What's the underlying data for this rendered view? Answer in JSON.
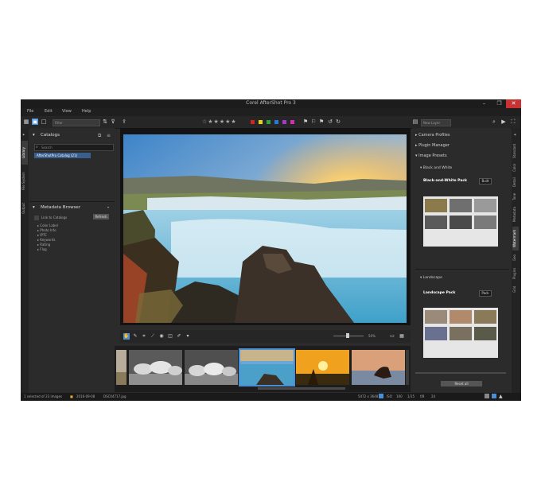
{
  "window": {
    "title": "Corel AfterShot Pro 3",
    "min": "–",
    "max": "❐",
    "close": "✕"
  },
  "menu": [
    "File",
    "Edit",
    "View",
    "Help"
  ],
  "toolbar": {
    "filter_dropdown": "Filter",
    "stars": "☆★★★★★",
    "labels": [
      "#d42525",
      "#e2d21e",
      "#2ea43a",
      "#2a78d6",
      "#a638c8",
      "#d12fb0"
    ],
    "layers_dropdown": "New Layer"
  },
  "left_tabs": [
    "Library",
    "File System",
    "Output"
  ],
  "catalog": {
    "title": "Catalogs",
    "search_placeholder": "Search",
    "selected_item": "AfterShotPro Catalog (21)"
  },
  "metadata": {
    "title": "Metadata Browser",
    "link_label": "Link to Catalogs",
    "refresh_label": "Refresh",
    "items": [
      "Color Label",
      "Photo Info",
      "IPTC",
      "Keywords",
      "Rating",
      "Flag"
    ]
  },
  "right_panel": {
    "rows": [
      "Camera Profiles",
      "Plugin Manager",
      "Image Presets"
    ],
    "bw_section": "Black and White",
    "bw_pack": "Black-and-White Pack",
    "bw_badge": "Built",
    "landscape_section": "Landscape",
    "landscape_pack": "Landscape Pack",
    "landscape_badge": "Pack",
    "reset_label": "Reset all"
  },
  "right_tabs": [
    "Standard",
    "Color",
    "Detail",
    "Tone",
    "Metadata",
    "Watermark",
    "Geo",
    "Plugins",
    "Grid"
  ],
  "edit_tools": {
    "zoom_label": "50%"
  },
  "status": {
    "selection": "1 selected of 23 images",
    "date": "2016-09-08",
    "filename": "DSC04717.jpg",
    "dims": "5472 x 3648",
    "meta": [
      "ISO",
      "100",
      "1/15",
      "f/8",
      "24"
    ]
  }
}
